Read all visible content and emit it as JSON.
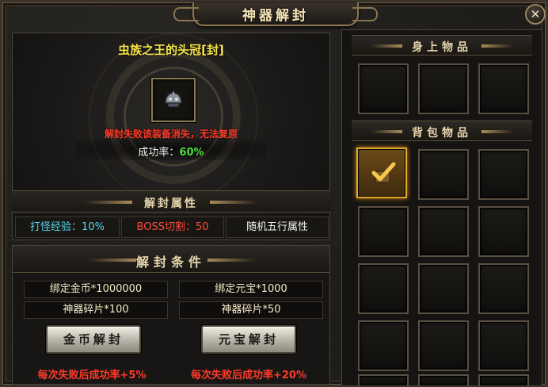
{
  "window": {
    "title": "神器解封",
    "close_label": "✕"
  },
  "artifact": {
    "item_name": "虫族之王的头冠[封]",
    "warning": "解封失败该装备消失，无法复原",
    "rate_label": "成功率：",
    "rate_value": "60%",
    "attributes_header": "解封属性",
    "attributes": [
      {
        "label": "打怪经验：10%",
        "color": "#56d8f0"
      },
      {
        "label": "BOSS切割：50",
        "color": "#ff4a3a"
      },
      {
        "label": "随机五行属性",
        "color": "#f2f2f2"
      }
    ]
  },
  "conditions": {
    "header": "解封条件",
    "gold": {
      "cost": "绑定金币*1000000",
      "fragments": "神器碎片*100",
      "button": "金币解封",
      "bonus": "每次失败后成功率+5%"
    },
    "ingot": {
      "cost": "绑定元宝*1000",
      "fragments": "神器碎片*50",
      "button": "元宝解封",
      "bonus": "每次失败后成功率+20%"
    }
  },
  "inventory": {
    "equipped_header": "身上物品",
    "bag_header": "背包物品",
    "equipped_slots": 3,
    "bag_slots": 15,
    "selected_bag_slot": 0,
    "selected_icon": "checkmark-icon"
  },
  "colors": {
    "gold_text": "#f5e44a",
    "warning_red": "#ff3a2a",
    "success_green": "#49e03c",
    "selected_slot": "#e4a82a"
  }
}
